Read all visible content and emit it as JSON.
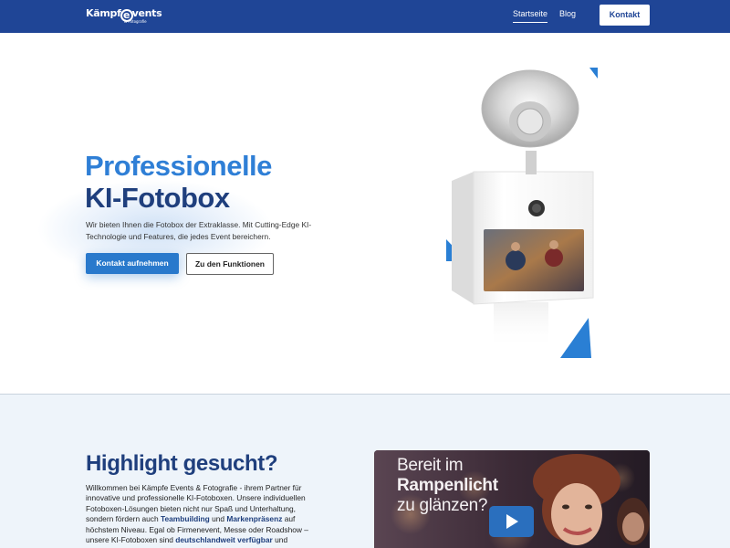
{
  "nav": {
    "logo_text_a": "Kämpf",
    "logo_text_e": "e",
    "logo_text_b": "vents",
    "logo_sub": "& Fotografie",
    "links": [
      {
        "label": "Startseite",
        "active": true
      },
      {
        "label": "Blog",
        "active": false
      }
    ],
    "cta_label": "Kontakt",
    "bg_color": "#1f4596"
  },
  "hero": {
    "title_line1": "Professionelle",
    "title_line2": "KI-Fotobox",
    "description": "Wir bieten Ihnen die Fotobox der Extraklasse. Mit Cutting-Edge KI-Technologie und Features, die jedes Event bereichern.",
    "primary_button": "Kontakt aufnehmen",
    "secondary_button": "Zu den Funktionen",
    "image_icon": "ki-fotobox-photo",
    "accent_color": "#2f7fd6",
    "dark_color": "#1f3f7d"
  },
  "highlight": {
    "heading": "Highlight gesucht?",
    "body": [
      {
        "t": "Willkommen bei Kämpfe Events & Fotografie - ihrem Partner für innovative und professionelle KI-Fotoboxen. Unsere individuellen Fotoboxen-Lösungen bieten nicht nur Spaß und Unterhaltung, sondern fördern auch ",
        "b": false
      },
      {
        "t": "Teambuilding",
        "b": true
      },
      {
        "t": " und ",
        "b": false
      },
      {
        "t": "Markenpräsenz",
        "b": true
      },
      {
        "t": " auf höchstem Niveau. Egal ob Firmenevent, Messe oder Roadshow – unsere KI-Fotoboxen sind ",
        "b": false
      },
      {
        "t": "deutschlandweit verfügbar",
        "b": true
      },
      {
        "t": " und",
        "b": false
      }
    ],
    "video": {
      "line1": "Bereit im",
      "line2": "Rampenlicht",
      "line3": "zu glänzen?",
      "play_icon": "play-icon"
    },
    "bg_color": "#eef4fa"
  }
}
